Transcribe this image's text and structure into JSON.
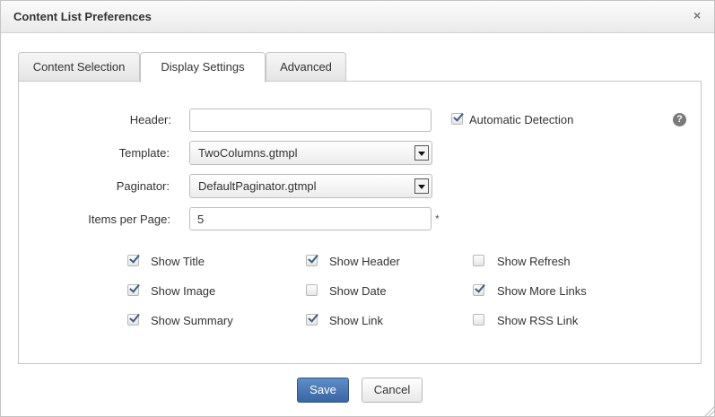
{
  "dialog": {
    "title": "Content List Preferences",
    "close_glyph": "×"
  },
  "tabs": [
    {
      "label": "Content Selection",
      "active": false
    },
    {
      "label": "Display Settings",
      "active": true
    },
    {
      "label": "Advanced",
      "active": false
    }
  ],
  "form": {
    "header": {
      "label": "Header:",
      "value": "",
      "placeholder": ""
    },
    "auto_detect": {
      "label": "Automatic Detection",
      "checked": true
    },
    "template": {
      "label": "Template:",
      "value": "TwoColumns.gtmpl"
    },
    "paginator": {
      "label": "Paginator:",
      "value": "DefaultPaginator.gtmpl"
    },
    "items_per_page": {
      "label": "Items per Page:",
      "value": "5",
      "required_mark": "*"
    },
    "help_glyph": "?"
  },
  "options": [
    {
      "label": "Show Title",
      "checked": true
    },
    {
      "label": "Show Header",
      "checked": true
    },
    {
      "label": "Show Refresh",
      "checked": false
    },
    {
      "label": "Show Image",
      "checked": true
    },
    {
      "label": "Show Date",
      "checked": false
    },
    {
      "label": "Show More Links",
      "checked": true
    },
    {
      "label": "Show Summary",
      "checked": true
    },
    {
      "label": "Show Link",
      "checked": true
    },
    {
      "label": "Show RSS Link",
      "checked": false
    }
  ],
  "buttons": {
    "save": "Save",
    "cancel": "Cancel"
  },
  "colors": {
    "primary_button": "#3a66a3",
    "checkmark": "#3d5e82"
  }
}
